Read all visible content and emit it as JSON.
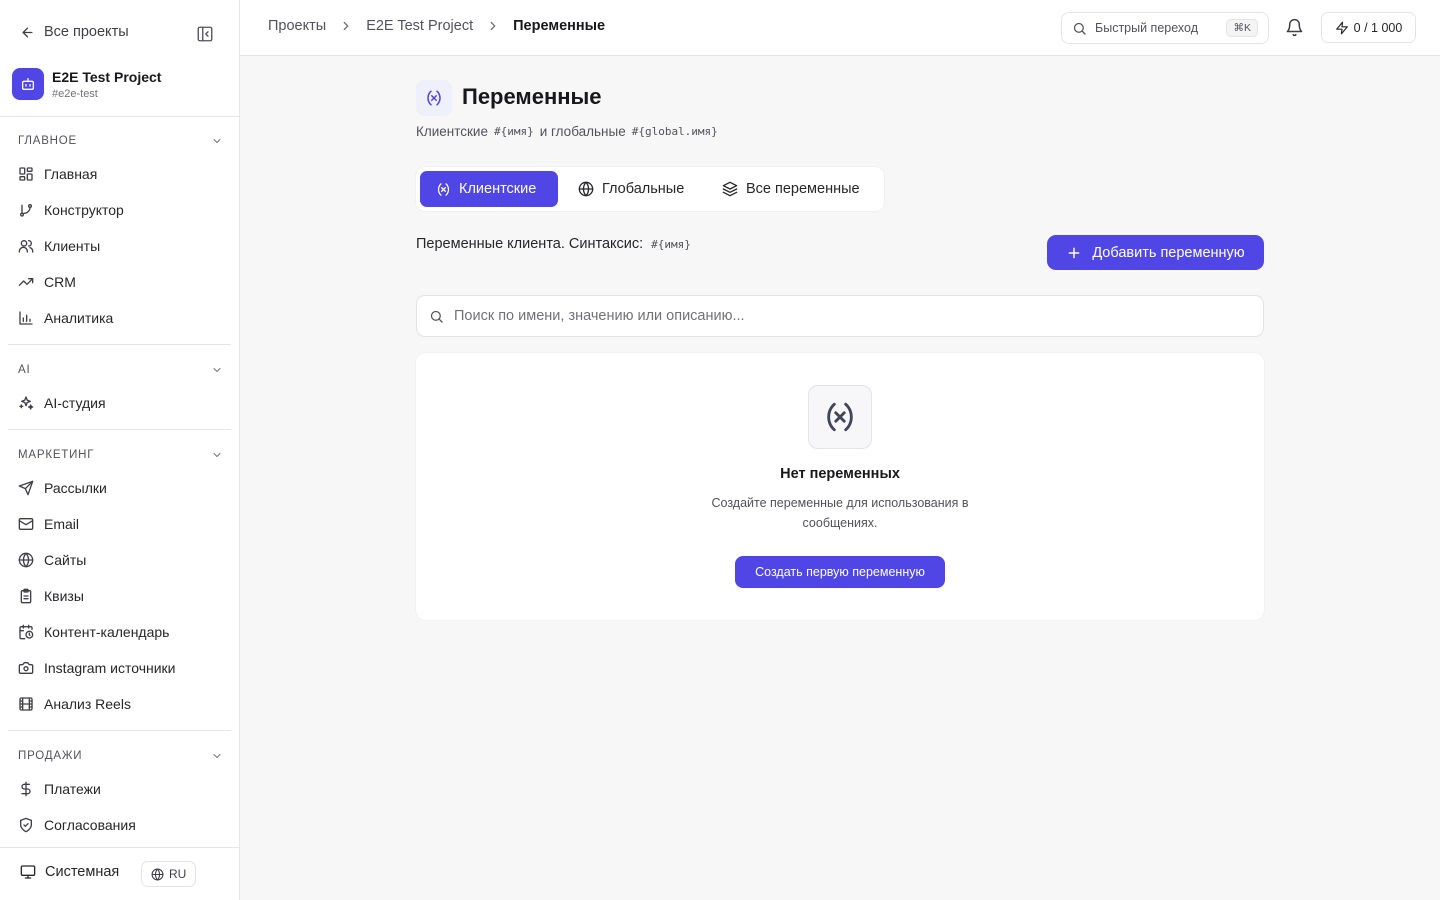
{
  "sidebar": {
    "back_label": "Все проекты",
    "project": {
      "name": "E2E Test Project",
      "slug": "#e2e-test"
    },
    "sections": {
      "main": {
        "title": "ГЛАВНОЕ",
        "items": [
          "Главная",
          "Конструктор",
          "Клиенты",
          "CRM",
          "Аналитика"
        ]
      },
      "ai": {
        "title": "AI",
        "items": [
          "AI-студия"
        ]
      },
      "marketing": {
        "title": "МАРКЕТИНГ",
        "items": [
          "Рассылки",
          "Email",
          "Сайты",
          "Квизы",
          "Контент-календарь",
          "Instagram источники",
          "Анализ Reels"
        ]
      },
      "sales": {
        "title": "ПРОДАЖИ",
        "items": [
          "Платежи",
          "Согласования"
        ]
      }
    },
    "theme_label": "Системная",
    "language": "RU"
  },
  "header": {
    "breadcrumbs": [
      "Проекты",
      "E2E Test Project",
      "Переменные"
    ],
    "quick_jump": {
      "label": "Быстрый переход",
      "shortcut": "⌘K"
    },
    "credits": "0 / 1 000"
  },
  "page": {
    "title": "Переменные",
    "subtitle": {
      "client_text": "Клиентские",
      "client_syntax": "#{имя}",
      "and_global_text": "и глобальные",
      "global_syntax": "#{global.имя}"
    },
    "tabs": [
      "Клиентские",
      "Глобальные",
      "Все переменные"
    ],
    "active_tab": "Клиентские",
    "client_description": "Переменные клиента. Синтаксис:",
    "client_syntax": "#{имя}",
    "add_button": "Добавить переменную",
    "search_placeholder": "Поиск по имени, значению или описанию...",
    "empty": {
      "title": "Нет переменных",
      "text": "Создайте переменные для использования в сообщениях.",
      "button": "Создать первую переменную"
    }
  },
  "colors": {
    "accent": "#4f46e5",
    "background": "#f7f7f8"
  }
}
